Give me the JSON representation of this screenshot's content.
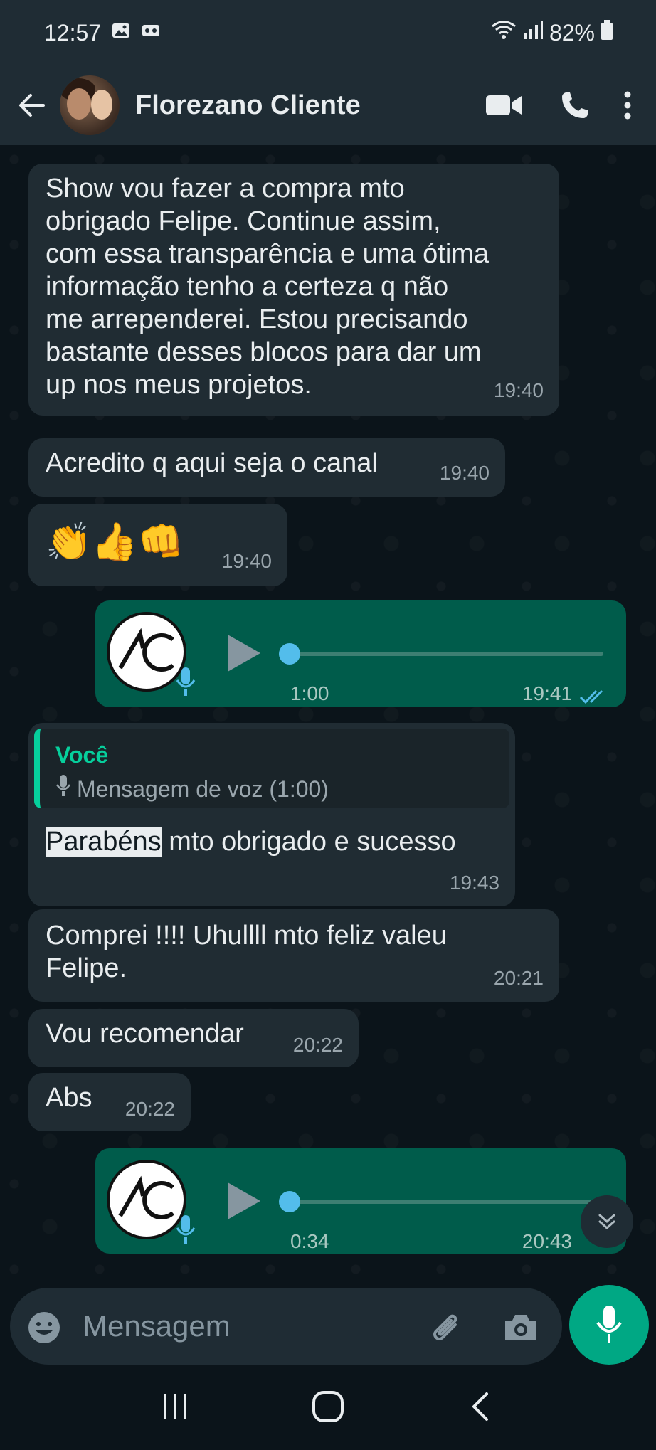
{
  "status": {
    "time": "12:57",
    "battery": "82%"
  },
  "header": {
    "name": "Florezano Cliente"
  },
  "messages": {
    "m1": {
      "text": [
        "Show vou fazer a compra mto",
        "obrigado Felipe. Continue assim,",
        "com essa transparência e uma ótima",
        "informação tenho a certeza q não",
        "me arrependerei. Estou precisando",
        "bastante desses blocos para dar um",
        "up nos meus projetos."
      ],
      "time": "19:40"
    },
    "m2": {
      "text": "Acredito q aqui seja o canal",
      "time": "19:40"
    },
    "m3": {
      "text": "👏👍👊",
      "time": "19:40"
    },
    "a1": {
      "duration": "1:00",
      "time": "19:41",
      "progress": 0.0
    },
    "m4": {
      "quote_author": "Você",
      "quote_text": "Mensagem de voz (1:00)",
      "text_highlight": "Parabéns",
      "text_rest": " mto obrigado e sucesso",
      "time": "19:43"
    },
    "m5": {
      "text": [
        "Comprei !!!! Uhullll mto feliz valeu",
        "Felipe."
      ],
      "time": "20:21"
    },
    "m6": {
      "text": "Vou recomendar",
      "time": "20:22"
    },
    "m7": {
      "text": "Abs",
      "time": "20:22"
    },
    "a2": {
      "duration": "0:34",
      "time": "20:43",
      "progress": 0.0
    }
  },
  "input": {
    "placeholder": "Mensagem"
  },
  "colors": {
    "incoming": "#202c33",
    "outgoing": "#005c4b",
    "accent": "#00a884",
    "read_tick": "#53bdeb"
  }
}
